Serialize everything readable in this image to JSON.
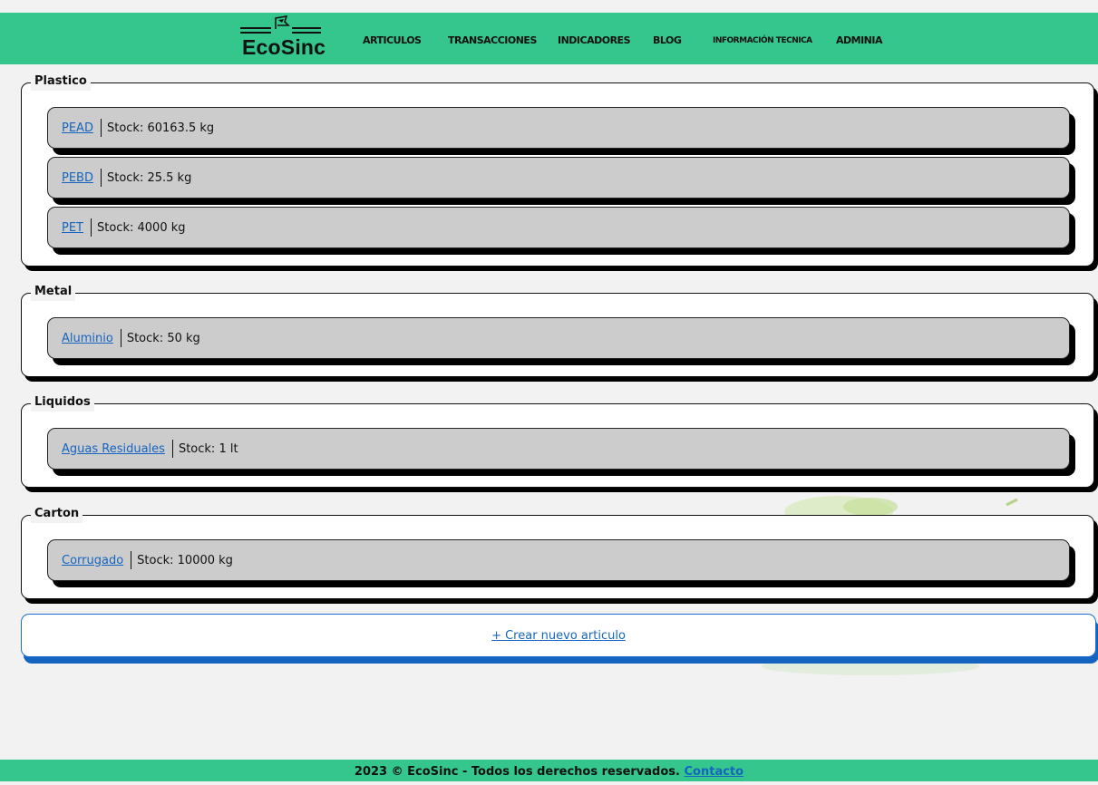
{
  "header": {
    "logo_text": "EcoSinc",
    "nav": [
      {
        "label": "ARTICULOS"
      },
      {
        "label": "TRANSACCIONES"
      },
      {
        "label": "INDICADORES"
      },
      {
        "label": "BLOG"
      },
      {
        "label": "INFORMACIÓN TECNICA"
      },
      {
        "label": "ADMINIA"
      }
    ]
  },
  "categories": [
    {
      "name": "Plastico",
      "items": [
        {
          "name": "PEAD",
          "stock_label": "Stock:",
          "stock": "60163.5 kg"
        },
        {
          "name": "PEBD",
          "stock_label": "Stock:",
          "stock": "25.5 kg"
        },
        {
          "name": "PET",
          "stock_label": "Stock:",
          "stock": "4000 kg"
        }
      ]
    },
    {
      "name": "Metal",
      "items": [
        {
          "name": "Aluminio",
          "stock_label": "Stock:",
          "stock": "50 kg"
        }
      ]
    },
    {
      "name": "Liquidos",
      "items": [
        {
          "name": "Aguas Residuales",
          "stock_label": "Stock:",
          "stock": "1 lt"
        }
      ]
    },
    {
      "name": "Carton",
      "items": [
        {
          "name": "Corrugado",
          "stock_label": "Stock:",
          "stock": "10000 kg"
        }
      ]
    }
  ],
  "create_button": {
    "label": "+ Crear nuevo articulo"
  },
  "footer": {
    "text": "2023 © EcoSinc - Todos los derechos reservados.",
    "contact_label": "Contacto"
  },
  "colors": {
    "header_bg": "#34c68c",
    "link": "#1565c0",
    "item_bg": "#cccccc",
    "page_bg": "#f2f2f2"
  }
}
